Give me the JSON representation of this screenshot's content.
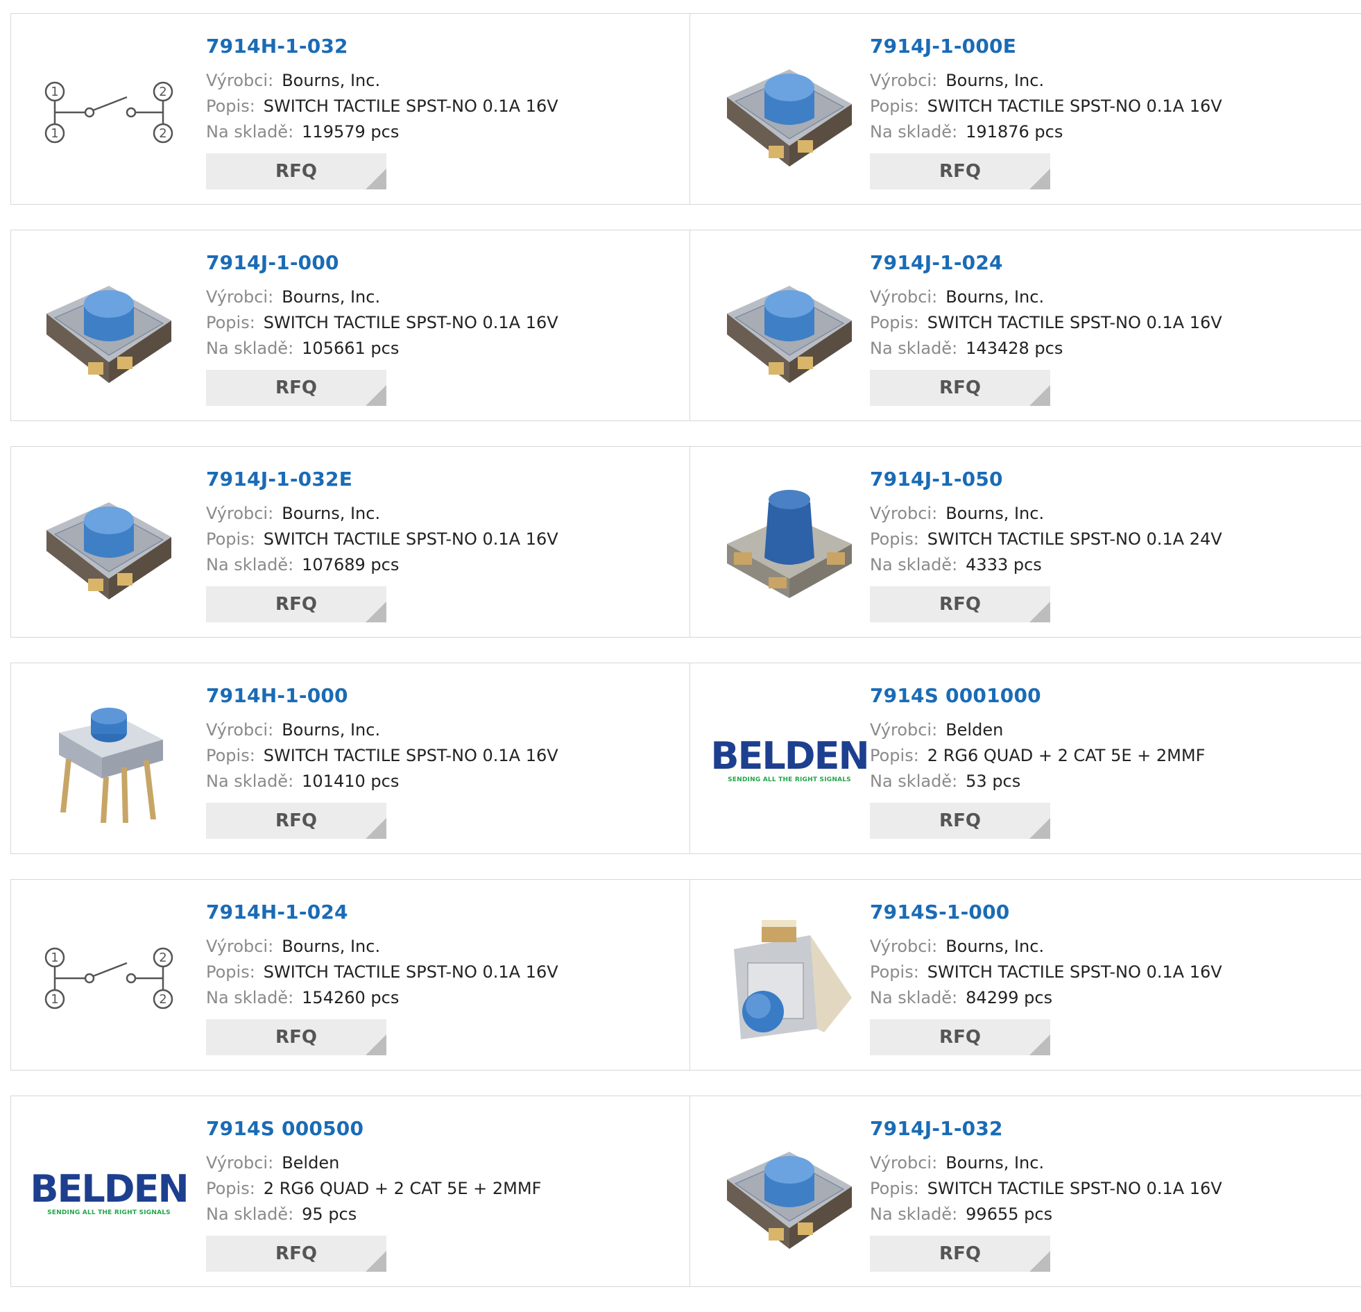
{
  "labels": {
    "manufacturer": "Výrobci:",
    "description": "Popis:",
    "stock": "Na skladě:",
    "rfq": "RFQ"
  },
  "belden_logo": {
    "name": "BELDEN",
    "tagline": "SENDING ALL THE RIGHT SIGNALS"
  },
  "products": [
    {
      "part": "7914H-1-032",
      "manufacturer": "Bourns, Inc.",
      "description": "SWITCH TACTILE SPST-NO 0.1A 16V",
      "stock": "119579 pcs",
      "image": "schematic-switch-icon"
    },
    {
      "part": "7914J-1-000E",
      "manufacturer": "Bourns, Inc.",
      "description": "SWITCH TACTILE SPST-NO 0.1A 16V",
      "stock": "191876 pcs",
      "image": "tactile-switch-photo"
    },
    {
      "part": "7914J-1-000",
      "manufacturer": "Bourns, Inc.",
      "description": "SWITCH TACTILE SPST-NO 0.1A 16V",
      "stock": "105661 pcs",
      "image": "tactile-switch-photo"
    },
    {
      "part": "7914J-1-024",
      "manufacturer": "Bourns, Inc.",
      "description": "SWITCH TACTILE SPST-NO 0.1A 16V",
      "stock": "143428 pcs",
      "image": "tactile-switch-photo"
    },
    {
      "part": "7914J-1-032E",
      "manufacturer": "Bourns, Inc.",
      "description": "SWITCH TACTILE SPST-NO 0.1A 16V",
      "stock": "107689 pcs",
      "image": "tactile-switch-photo"
    },
    {
      "part": "7914J-1-050",
      "manufacturer": "Bourns, Inc.",
      "description": "SWITCH TACTILE SPST-NO 0.1A 24V",
      "stock": "4333 pcs",
      "image": "tall-tactile-switch-photo"
    },
    {
      "part": "7914H-1-000",
      "manufacturer": "Bourns, Inc.",
      "description": "SWITCH TACTILE SPST-NO 0.1A 16V",
      "stock": "101410 pcs",
      "image": "through-hole-switch-photo"
    },
    {
      "part": "7914S 0001000",
      "manufacturer": "Belden",
      "description": "2 RG6 QUAD + 2 CAT 5E + 2MMF",
      "stock": "53 pcs",
      "image": "belden-logo"
    },
    {
      "part": "7914H-1-024",
      "manufacturer": "Bourns, Inc.",
      "description": "SWITCH TACTILE SPST-NO 0.1A 16V",
      "stock": "154260 pcs",
      "image": "schematic-switch-icon"
    },
    {
      "part": "7914S-1-000",
      "manufacturer": "Bourns, Inc.",
      "description": "SWITCH TACTILE SPST-NO 0.1A 16V",
      "stock": "84299 pcs",
      "image": "side-tactile-switch-photo"
    },
    {
      "part": "7914S 000500",
      "manufacturer": "Belden",
      "description": "2 RG6 QUAD + 2 CAT 5E + 2MMF",
      "stock": "95 pcs",
      "image": "belden-logo"
    },
    {
      "part": "7914J-1-032",
      "manufacturer": "Bourns, Inc.",
      "description": "SWITCH TACTILE SPST-NO 0.1A 16V",
      "stock": "99655 pcs",
      "image": "tactile-switch-photo"
    }
  ]
}
